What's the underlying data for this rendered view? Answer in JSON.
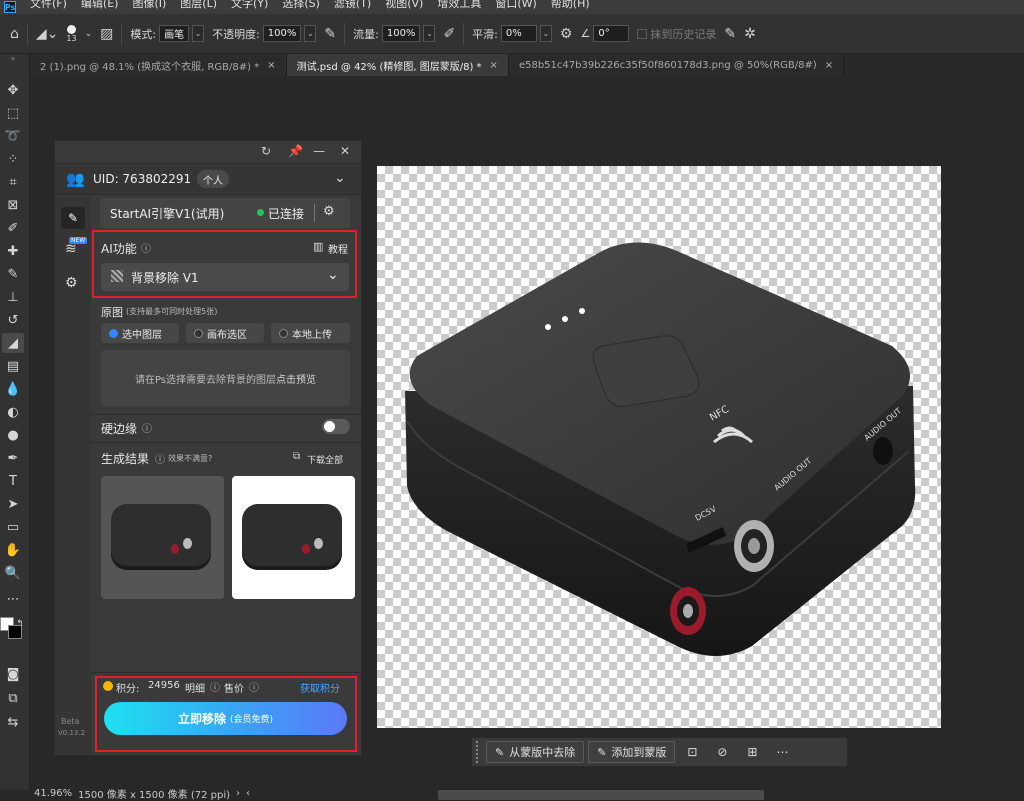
{
  "menubar": {
    "logo": "Ps",
    "items": [
      "文件(F)",
      "编辑(E)",
      "图像(I)",
      "图层(L)",
      "文字(Y)",
      "选择(S)",
      "滤镜(T)",
      "视图(V)",
      "增效工具",
      "窗口(W)",
      "帮助(H)"
    ]
  },
  "options": {
    "brush_size": "13",
    "mode_label": "模式:",
    "mode_value": "画笔",
    "opacity_label": "不透明度:",
    "opacity_value": "100%",
    "flow_label": "流量:",
    "flow_value": "100%",
    "smooth_label": "平滑:",
    "smooth_value": "0%",
    "angle_value": "0°",
    "history_label": "抹到历史记录"
  },
  "tabs": [
    {
      "label": "2 (1).png @ 48.1% (换成这个衣服, RGB/8#) *"
    },
    {
      "label": "测试.psd @ 42% (精修图, 图层蒙版/8) *"
    },
    {
      "label": "e58b51c47b39b226c35f50f860178d3.png @ 50%(RGB/8#)"
    }
  ],
  "panel": {
    "uid_label": "UID: 763802291",
    "uid_badge": "个人",
    "engine_name": "StartAI引擎V1(试用)",
    "engine_status": "已连接",
    "ai_feature_label": "AI功能",
    "tutorial_label": "教程",
    "feature_selected": "背景移除 V1",
    "new_badge": "NEW",
    "source_label": "原图",
    "source_hint": "(支持最多可同时处理5张)",
    "source_options": [
      "选中图层",
      "画布选区",
      "本地上传"
    ],
    "drop_hint": "请在Ps选择需要去除背景的图层",
    "drop_link": "点击预览",
    "hard_edge_label": "硬边缘",
    "result_label": "生成结果",
    "result_hint": "效果不满意?",
    "download_all": "下载全部",
    "points_label": "积分:",
    "points_value": "24956",
    "detail_label": "明细",
    "price_label": "售价",
    "get_points": "获取积分",
    "cta_label": "立即移除",
    "cta_sub": "(会员免费)",
    "version_beta": "Beta",
    "version": "V0.13.2"
  },
  "floatbar": {
    "remove_label": "从蒙版中去除",
    "add_label": "添加到蒙版"
  },
  "status": {
    "zoom": "41.96%",
    "doc_info": "1500 像素 x 1500 像素 (72 ppi)"
  },
  "product_labels": {
    "nfc": "NFC",
    "audio_out_side": "AUDIO OUT",
    "audio_out_right": "AUDIO OUT",
    "dc5v": "DC5V"
  },
  "colors": {
    "accent_red": "#e0202a",
    "status_green": "#22c55e",
    "cta_start": "#1de1f0",
    "cta_end": "#5b79f7"
  }
}
